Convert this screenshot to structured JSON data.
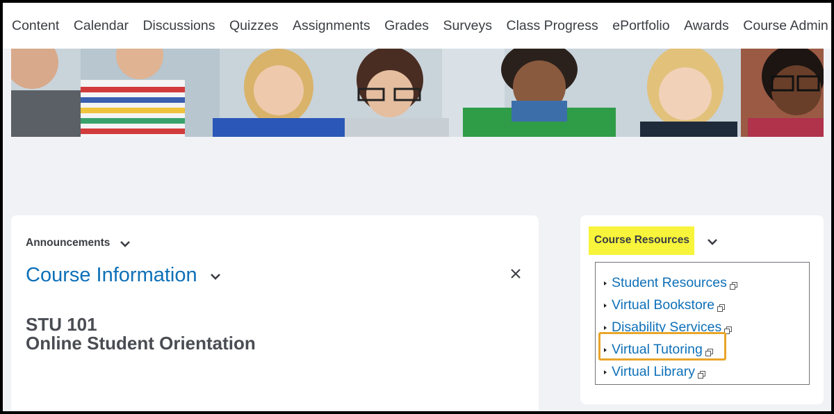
{
  "nav": {
    "items": [
      "Content",
      "Calendar",
      "Discussions",
      "Quizzes",
      "Assignments",
      "Grades",
      "Surveys",
      "Class Progress",
      "ePortfolio",
      "Awards",
      "Course Admin"
    ]
  },
  "announcements": {
    "title": "Announcements"
  },
  "course_info": {
    "title": "Course Information",
    "code": "STU 101",
    "name": "Online Student Orientation"
  },
  "resources": {
    "title": "Course Resources",
    "items": [
      {
        "label": "Student Resources"
      },
      {
        "label": "Virtual Bookstore"
      },
      {
        "label": "Disability Services"
      },
      {
        "label": "Virtual Tutoring"
      },
      {
        "label": "Virtual Library"
      }
    ],
    "highlighted_item": "Virtual Tutoring"
  },
  "colors": {
    "link": "#0e70b8",
    "highlight_yellow": "#f7f43b",
    "highlight_orange": "#e9a52a",
    "page_bg": "#f1f2f5"
  }
}
